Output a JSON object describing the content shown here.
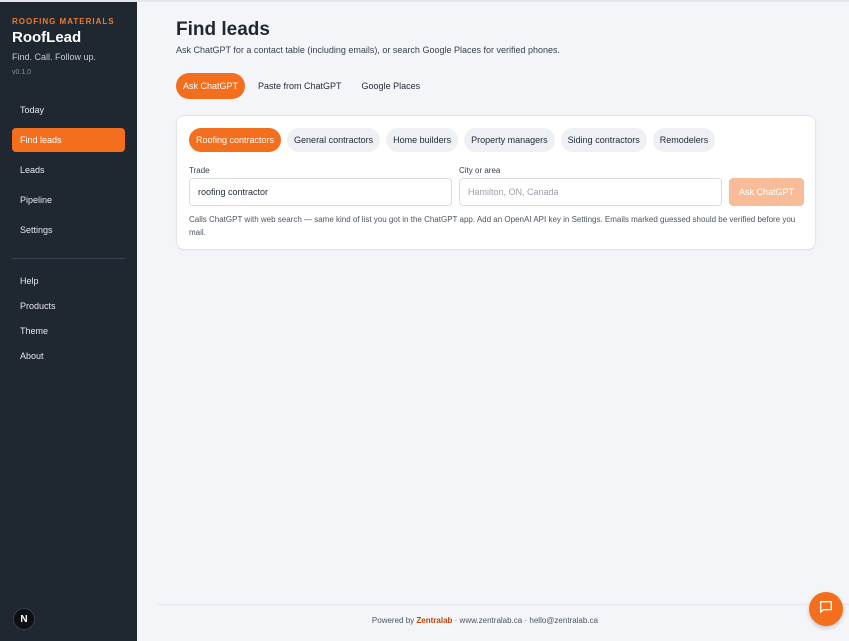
{
  "sidebar": {
    "eyebrow": "ROOFING MATERIALS",
    "app_name": "RoofLead",
    "tagline": "Find. Call. Follow up.",
    "version": "v0.1.0",
    "nav_primary": [
      {
        "label": "Today",
        "active": false
      },
      {
        "label": "Find leads",
        "active": true
      },
      {
        "label": "Leads",
        "active": false
      },
      {
        "label": "Pipeline",
        "active": false
      },
      {
        "label": "Settings",
        "active": false
      }
    ],
    "nav_secondary": [
      {
        "label": "Help"
      },
      {
        "label": "Products"
      },
      {
        "label": "Theme"
      },
      {
        "label": "About"
      }
    ],
    "avatar_letter": "N"
  },
  "page": {
    "title": "Find leads",
    "subtitle": "Ask ChatGPT for a contact table (including emails), or search Google Places for verified phones."
  },
  "mode_tabs": [
    {
      "label": "Ask ChatGPT",
      "active": true
    },
    {
      "label": "Paste from ChatGPT",
      "active": false
    },
    {
      "label": "Google Places",
      "active": false
    }
  ],
  "chips": [
    {
      "label": "Roofing contractors",
      "active": true
    },
    {
      "label": "General contractors",
      "active": false
    },
    {
      "label": "Home builders",
      "active": false
    },
    {
      "label": "Property managers",
      "active": false
    },
    {
      "label": "Siding contractors",
      "active": false
    },
    {
      "label": "Remodelers",
      "active": false
    }
  ],
  "form": {
    "trade_label": "Trade",
    "trade_value": "roofing contractor",
    "city_label": "City or area",
    "city_placeholder": "Hamilton, ON, Canada",
    "city_value": "",
    "submit_label": "Ask ChatGPT",
    "hint": "Calls ChatGPT with web search — same kind of list you got in the ChatGPT app. Add an OpenAI API key in Settings. Emails marked guessed should be verified before you mail."
  },
  "footer": {
    "prefix": "Powered by",
    "brand": "Zentralab",
    "sep1": "·",
    "site": "www.zentralab.ca",
    "sep2": "·",
    "email": "hello@zentralab.ca"
  },
  "colors": {
    "accent": "#f36f1e",
    "sidebar_bg": "#1f2731",
    "page_bg": "#f4f5f8",
    "submit_disabled": "#f8bd98"
  },
  "icons": {
    "chat_fab": "chat-bubble-icon"
  }
}
